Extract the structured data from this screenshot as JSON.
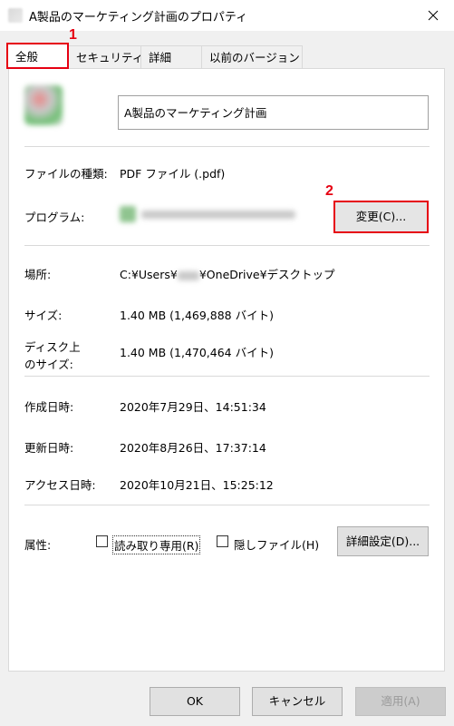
{
  "window": {
    "title": "A製品のマーケティング計画のプロパティ",
    "close_icon": "close-icon"
  },
  "tabs": [
    {
      "label": "全般",
      "active": true
    },
    {
      "label": "セキュリティ"
    },
    {
      "label": "詳細"
    },
    {
      "label": "以前のバージョン"
    }
  ],
  "annotations": {
    "n1": "1",
    "n2": "2"
  },
  "general": {
    "file_name": "A製品のマーケティング計画",
    "file_type_label": "ファイルの種類:",
    "file_type_value": "PDF ファイル (.pdf)",
    "program_label": "プログラム:",
    "change_button": "変更(C)...",
    "location_label": "場所:",
    "location_prefix": "C:¥Users¥",
    "location_suffix": "¥OneDrive¥デスクトップ",
    "size_label": "サイズ:",
    "size_value": "1.40 MB (1,469,888 バイト)",
    "disk_size_label_1": "ディスク上",
    "disk_size_label_2": "のサイズ:",
    "disk_size_value": "1.40 MB (1,470,464 バイト)",
    "created_label": "作成日時:",
    "created_value": "2020年7月29日、14:51:34",
    "modified_label": "更新日時:",
    "modified_value": "2020年8月26日、17:37:14",
    "accessed_label": "アクセス日時:",
    "accessed_value": "2020年10月21日、15:25:12",
    "attributes_label": "属性:",
    "readonly_label": "読み取り専用(R)",
    "readonly_checked": false,
    "hidden_label": "隠しファイル(H)",
    "hidden_checked": false,
    "advanced_button": "詳細設定(D)..."
  },
  "footer": {
    "ok": "OK",
    "cancel": "キャンセル",
    "apply": "適用(A)"
  },
  "colors": {
    "highlight": "#e60012"
  }
}
